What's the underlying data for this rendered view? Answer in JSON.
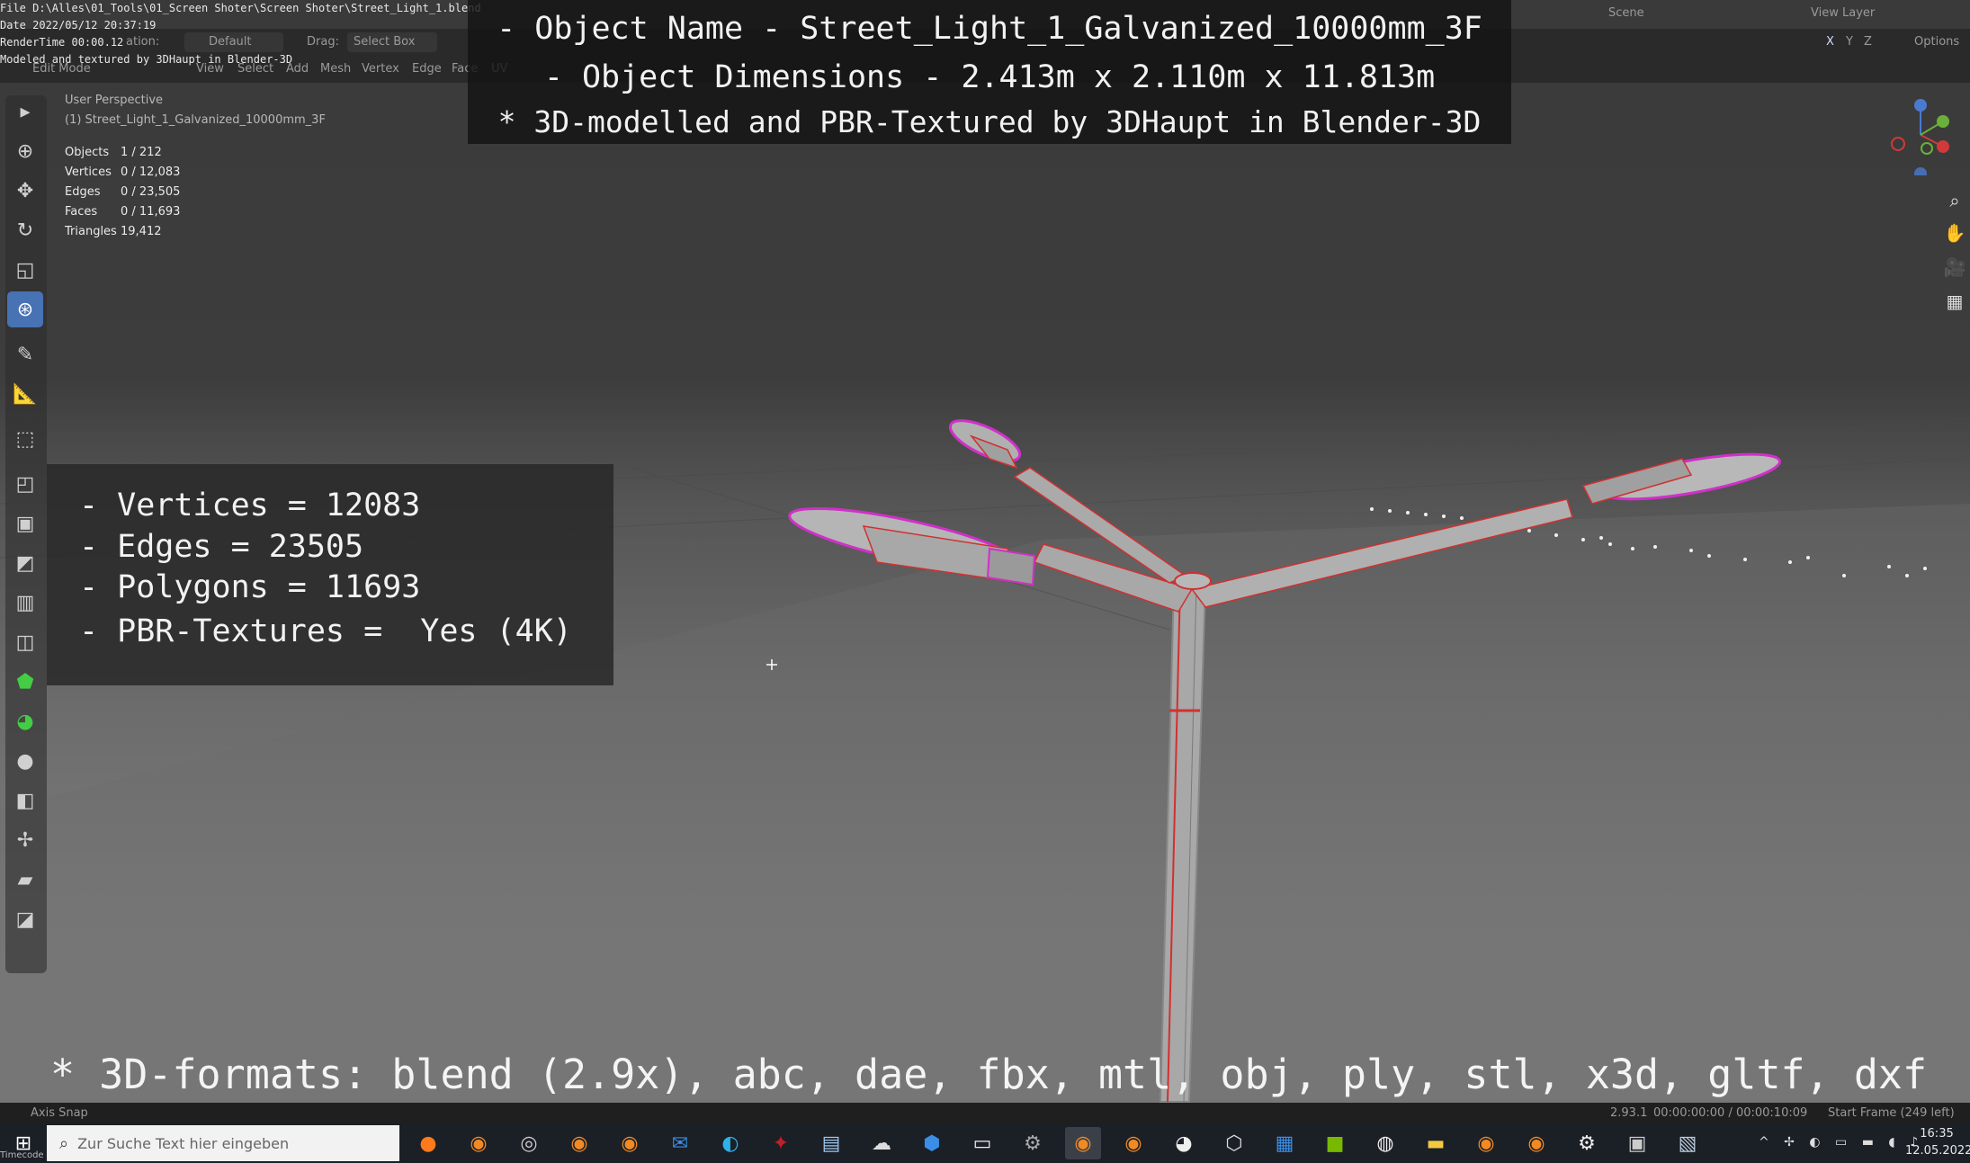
{
  "meta": {
    "file_line": "File D:\\Alles\\01_Tools\\01_Screen Shoter\\Screen Shoter\\Street_Light_1.blend",
    "date_line": "Date 2022/05/12 20:37:19",
    "render_line": "RenderTime 00:00.12",
    "model_line": "Modeled and textured by 3DHaupt in Blender-3D"
  },
  "header": {
    "orientation_partial": "ation:",
    "orientation_value": "Default",
    "drag_label": "Drag:",
    "drag_value": "Select Box",
    "mode": "Edit Mode",
    "menus": [
      "View",
      "Select",
      "Add",
      "Mesh",
      "Vertex",
      "Edge",
      "Face",
      "UV"
    ],
    "scene": "Scene",
    "view_layer": "View Layer",
    "options": "Options",
    "axis_labels": [
      "X",
      "Y",
      "Z"
    ]
  },
  "banner": {
    "line1": "- Object Name - Street_Light_1_Galvanized_10000mm_3F",
    "line2": "- Object Dimensions -  2.413m x 2.110m x 11.813m",
    "line3": "* 3D-modelled and PBR-Textured by 3DHaupt in Blender-3D"
  },
  "viewport": {
    "perspective": "User Perspective",
    "object": "(1) Street_Light_1_Galvanized_10000mm_3F",
    "stats": [
      {
        "label": "Objects",
        "value": "1 / 212"
      },
      {
        "label": "Vertices",
        "value": "0 / 12,083"
      },
      {
        "label": "Edges",
        "value": "0 / 23,505"
      },
      {
        "label": "Faces",
        "value": "0 / 11,693"
      },
      {
        "label": "Triangles",
        "value": "19,412"
      }
    ]
  },
  "info": {
    "line1": "- Vertices = 12083",
    "line2": "- Edges = 23505",
    "line3": "- Polygons = 11693",
    "line4": "- PBR-Textures =  Yes (4K)"
  },
  "formats": "* 3D-formats: blend (2.9x), abc, dae, fbx, mtl, obj, ply, stl, x3d, gltf, dxf",
  "statusbar": {
    "left": "Axis Snap",
    "version": "2.93.1",
    "time": "00:00:00:00 / 00:00:10:09",
    "frame": "Start Frame (249 left)"
  },
  "taskbar": {
    "search_placeholder": "Zur Suche Text hier eingeben",
    "clock_time": "16:35",
    "clock_date": "12.05.2022",
    "timecode_label": "Timecode"
  },
  "colors": {
    "accent": "#4772b3",
    "wire_red": "#d23030",
    "wire_magenta": "#d030c8"
  }
}
